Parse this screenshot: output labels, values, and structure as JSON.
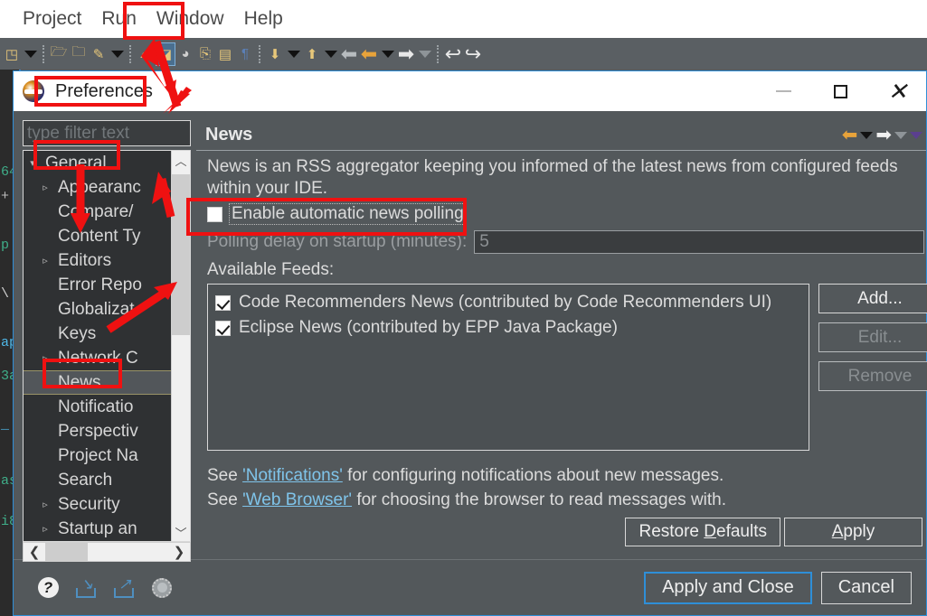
{
  "ide": {
    "menu_items": [
      "Project",
      "Run",
      "Window",
      "Help"
    ],
    "code_lines": [
      "64",
      "+",
      "p",
      "\\",
      "ap",
      "3a",
      "_",
      "as",
      "i8"
    ]
  },
  "dialog": {
    "title": "Preferences",
    "window_controls": {
      "minimize": "minimize-icon",
      "maximize": "maximize-icon",
      "close": "close-icon"
    },
    "filter_placeholder": "type filter text",
    "tree": [
      {
        "label": "General",
        "indent": 0,
        "expandable": true,
        "expanded": true,
        "selected": false
      },
      {
        "label": "Appearanc",
        "indent": 1,
        "expandable": true,
        "expanded": false,
        "selected": false
      },
      {
        "label": "Compare/",
        "indent": 1,
        "expandable": false,
        "expanded": false,
        "selected": false
      },
      {
        "label": "Content Ty",
        "indent": 1,
        "expandable": false,
        "expanded": false,
        "selected": false
      },
      {
        "label": "Editors",
        "indent": 1,
        "expandable": true,
        "expanded": false,
        "selected": false
      },
      {
        "label": "Error Repo",
        "indent": 1,
        "expandable": false,
        "expanded": false,
        "selected": false
      },
      {
        "label": "Globalizat",
        "indent": 1,
        "expandable": false,
        "expanded": false,
        "selected": false
      },
      {
        "label": "Keys",
        "indent": 1,
        "expandable": false,
        "expanded": false,
        "selected": false
      },
      {
        "label": "Network C",
        "indent": 1,
        "expandable": true,
        "expanded": false,
        "selected": false
      },
      {
        "label": "News",
        "indent": 1,
        "expandable": false,
        "expanded": false,
        "selected": true
      },
      {
        "label": "Notificatio",
        "indent": 1,
        "expandable": false,
        "expanded": false,
        "selected": false
      },
      {
        "label": "Perspectiv",
        "indent": 1,
        "expandable": false,
        "expanded": false,
        "selected": false
      },
      {
        "label": "Project Na",
        "indent": 1,
        "expandable": false,
        "expanded": false,
        "selected": false
      },
      {
        "label": "Search",
        "indent": 1,
        "expandable": false,
        "expanded": false,
        "selected": false
      },
      {
        "label": "Security",
        "indent": 1,
        "expandable": true,
        "expanded": false,
        "selected": false
      },
      {
        "label": "Startup an",
        "indent": 1,
        "expandable": true,
        "expanded": false,
        "selected": false
      }
    ],
    "page": {
      "title": "News",
      "description": "News is an RSS aggregator keeping you informed of the latest news from configured feeds within your IDE.",
      "enable_polling_label": "Enable automatic news polling",
      "enable_polling_checked": false,
      "delay_label": "Polling delay on startup (minutes):",
      "delay_value": "5",
      "feeds_label": "Available Feeds:",
      "feeds": [
        {
          "label": "Code Recommenders News (contributed by Code Recommenders UI)",
          "checked": true
        },
        {
          "label": "Eclipse News (contributed by EPP Java Package)",
          "checked": true
        }
      ],
      "side_buttons": [
        {
          "label": "Add...",
          "enabled": true
        },
        {
          "label": "Edit...",
          "enabled": false
        },
        {
          "label": "Remove",
          "enabled": false
        }
      ],
      "link_lines": [
        {
          "prefix": "See ",
          "link": "'Notifications'",
          "suffix": " for configuring notifications about new messages."
        },
        {
          "prefix": "See ",
          "link": "'Web Browser'",
          "suffix": " for choosing the browser to read messages with."
        }
      ],
      "restore_defaults_label": "Restore Defaults",
      "apply_label": "Apply"
    },
    "footer": {
      "apply_and_close_label": "Apply and Close",
      "cancel_label": "Cancel"
    }
  },
  "colors": {
    "annotation": "#ef1111",
    "accent": "#2e8fd8",
    "link": "#7fc4ea",
    "dialog_bg": "#53585b"
  }
}
